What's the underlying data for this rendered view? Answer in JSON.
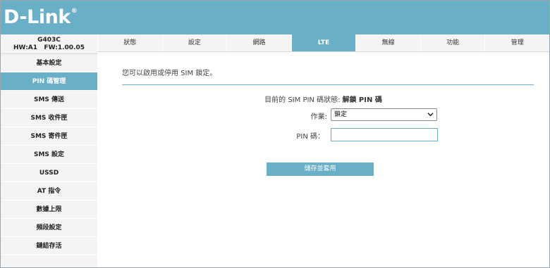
{
  "brand": {
    "logo_text": "D-Link",
    "logo_mark": "®"
  },
  "device": {
    "model": "G403C",
    "hw_fw": "HW:A1   FW:1.00.05"
  },
  "sidebar": {
    "items": [
      {
        "label": "基本設定"
      },
      {
        "label": "PIN 碼管理"
      },
      {
        "label": "SMS 傳送"
      },
      {
        "label": "SMS 收件匣"
      },
      {
        "label": "SMS 寄件匣"
      },
      {
        "label": "SMS 設定"
      },
      {
        "label": "USSD"
      },
      {
        "label": "AT 指令"
      },
      {
        "label": "數據上限"
      },
      {
        "label": "頻段設定"
      },
      {
        "label": "鏈結存活"
      }
    ],
    "active_index": 1
  },
  "tabs": {
    "items": [
      {
        "label": "狀態"
      },
      {
        "label": "設定"
      },
      {
        "label": "網路"
      },
      {
        "label": "LTE"
      },
      {
        "label": "無線"
      },
      {
        "label": "功能"
      },
      {
        "label": "管理"
      }
    ],
    "active_index": 3
  },
  "main": {
    "intro": "您可以啟用或停用 SIM 鎖定。",
    "status_label": "目前的 SIM PIN 碼狀態:",
    "status_value": "解鎖 PIN 碼",
    "action_label": "作業:",
    "action_value": "鎖定",
    "pin_label": "PIN 碼：",
    "pin_value": "",
    "save_label": "儲存並套用"
  },
  "colors": {
    "accent": "#6aafc8",
    "panel": "#f4f4f4"
  }
}
